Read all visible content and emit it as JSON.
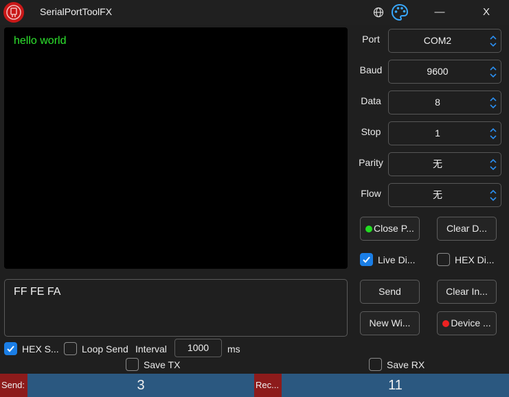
{
  "window": {
    "title": "SerialPortToolFX",
    "minimize": "—",
    "close": "X"
  },
  "receive": {
    "text": "hello world"
  },
  "send": {
    "text": "FF FE FA"
  },
  "settings": {
    "port": {
      "label": "Port",
      "value": "COM2"
    },
    "baud": {
      "label": "Baud",
      "value": "9600"
    },
    "data": {
      "label": "Data",
      "value": "8"
    },
    "stop": {
      "label": "Stop",
      "value": "1"
    },
    "parity": {
      "label": "Parity",
      "value": "无"
    },
    "flow": {
      "label": "Flow",
      "value": "无"
    }
  },
  "buttons": {
    "close_port": "Close P...",
    "clear_display": "Clear D...",
    "send": "Send",
    "clear_input": "Clear In...",
    "new_window": "New Wi...",
    "device": "Device ..."
  },
  "options": {
    "live_display": {
      "label": "Live Di...",
      "checked": true
    },
    "hex_display": {
      "label": "HEX Di...",
      "checked": false
    },
    "hex_send": {
      "label": "HEX S...",
      "checked": true
    },
    "loop_send": {
      "label": "Loop Send",
      "checked": false
    },
    "interval_label": "Interval",
    "interval_value": "1000",
    "interval_unit": "ms",
    "save_tx": {
      "label": "Save TX",
      "checked": false
    },
    "save_rx": {
      "label": "Save RX",
      "checked": false
    }
  },
  "status": {
    "send_label": "Send:",
    "send_count": "3",
    "recv_label": "Rec...",
    "recv_count": "11"
  },
  "colors": {
    "port_open_indicator": "#22dd22",
    "device_indicator": "#ee2222",
    "accent": "#1a7ee6",
    "statusbar": "#2b5880",
    "status_label_bg": "#8d1b1b"
  }
}
